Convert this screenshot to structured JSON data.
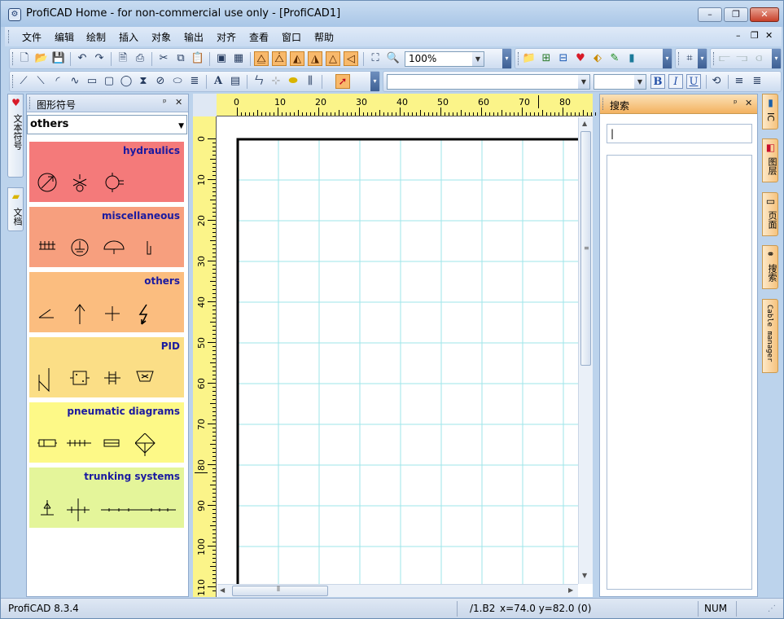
{
  "window": {
    "title": "ProfiCAD Home - for non-commercial use only - [ProfiCAD1]",
    "icon": "app-logo-icon",
    "controls": {
      "minimize": "–",
      "restore": "❐",
      "close": "✕"
    }
  },
  "menu": {
    "items": [
      "文件",
      "编辑",
      "绘制",
      "插入",
      "对象",
      "输出",
      "对齐",
      "查看",
      "窗口",
      "帮助"
    ],
    "mdi_controls": {
      "minimize": "–",
      "restore": "❐",
      "close": "✕"
    }
  },
  "toolbar_main": {
    "zoom": "100%"
  },
  "toolbar_format": {
    "font_name": "",
    "font_size": "",
    "bold": "B",
    "italic": "I",
    "underline": "U",
    "text_tool": "A"
  },
  "left_tabs": [
    {
      "label": "文本符号",
      "icon": "symbols-tab-icon"
    },
    {
      "label": "文档",
      "icon": "folder-icon"
    }
  ],
  "symbols_panel": {
    "title": "图形符号",
    "pin": "ᵖ",
    "close": "✕",
    "category_selected": "others",
    "categories": [
      {
        "label": "hydraulics",
        "color": "#f47a7a"
      },
      {
        "label": "miscellaneous",
        "color": "#f79f7e"
      },
      {
        "label": "others",
        "color": "#fbbd7f"
      },
      {
        "label": "PID",
        "color": "#fbde86"
      },
      {
        "label": "pneumatic diagrams",
        "color": "#fdf987"
      },
      {
        "label": "trunking systems",
        "color": "#e4f59a"
      }
    ]
  },
  "ruler": {
    "h_labels": [
      "0",
      "10",
      "20",
      "30",
      "40",
      "50",
      "60",
      "70",
      "80"
    ],
    "v_labels": [
      "0",
      "10",
      "20",
      "30",
      "40",
      "50",
      "60",
      "70",
      "80",
      "90",
      "100",
      "110"
    ]
  },
  "search_panel": {
    "title": "搜索",
    "pin": "ᵖ",
    "close": "✕",
    "input_value": "|"
  },
  "right_tabs": [
    {
      "label": "IC",
      "icon": "ic-icon"
    },
    {
      "label": "图层",
      "icon": "layers-icon"
    },
    {
      "label": "页面",
      "icon": "pages-icon"
    },
    {
      "label": "搜索",
      "icon": "binoculars-icon"
    },
    {
      "label": "Cable manager",
      "icon": ""
    }
  ],
  "status": {
    "app_version": "ProfiCAD 8.3.4",
    "sheet": "/1.B2",
    "coords": "x=74.0  y=82.0 (0)",
    "num": "NUM"
  },
  "colors": {
    "accent_orange": "#f8b96b",
    "ruler_yellow": "#fbf489",
    "grid_cyan": "#9ee6ea",
    "frame": "#3b5f93"
  }
}
